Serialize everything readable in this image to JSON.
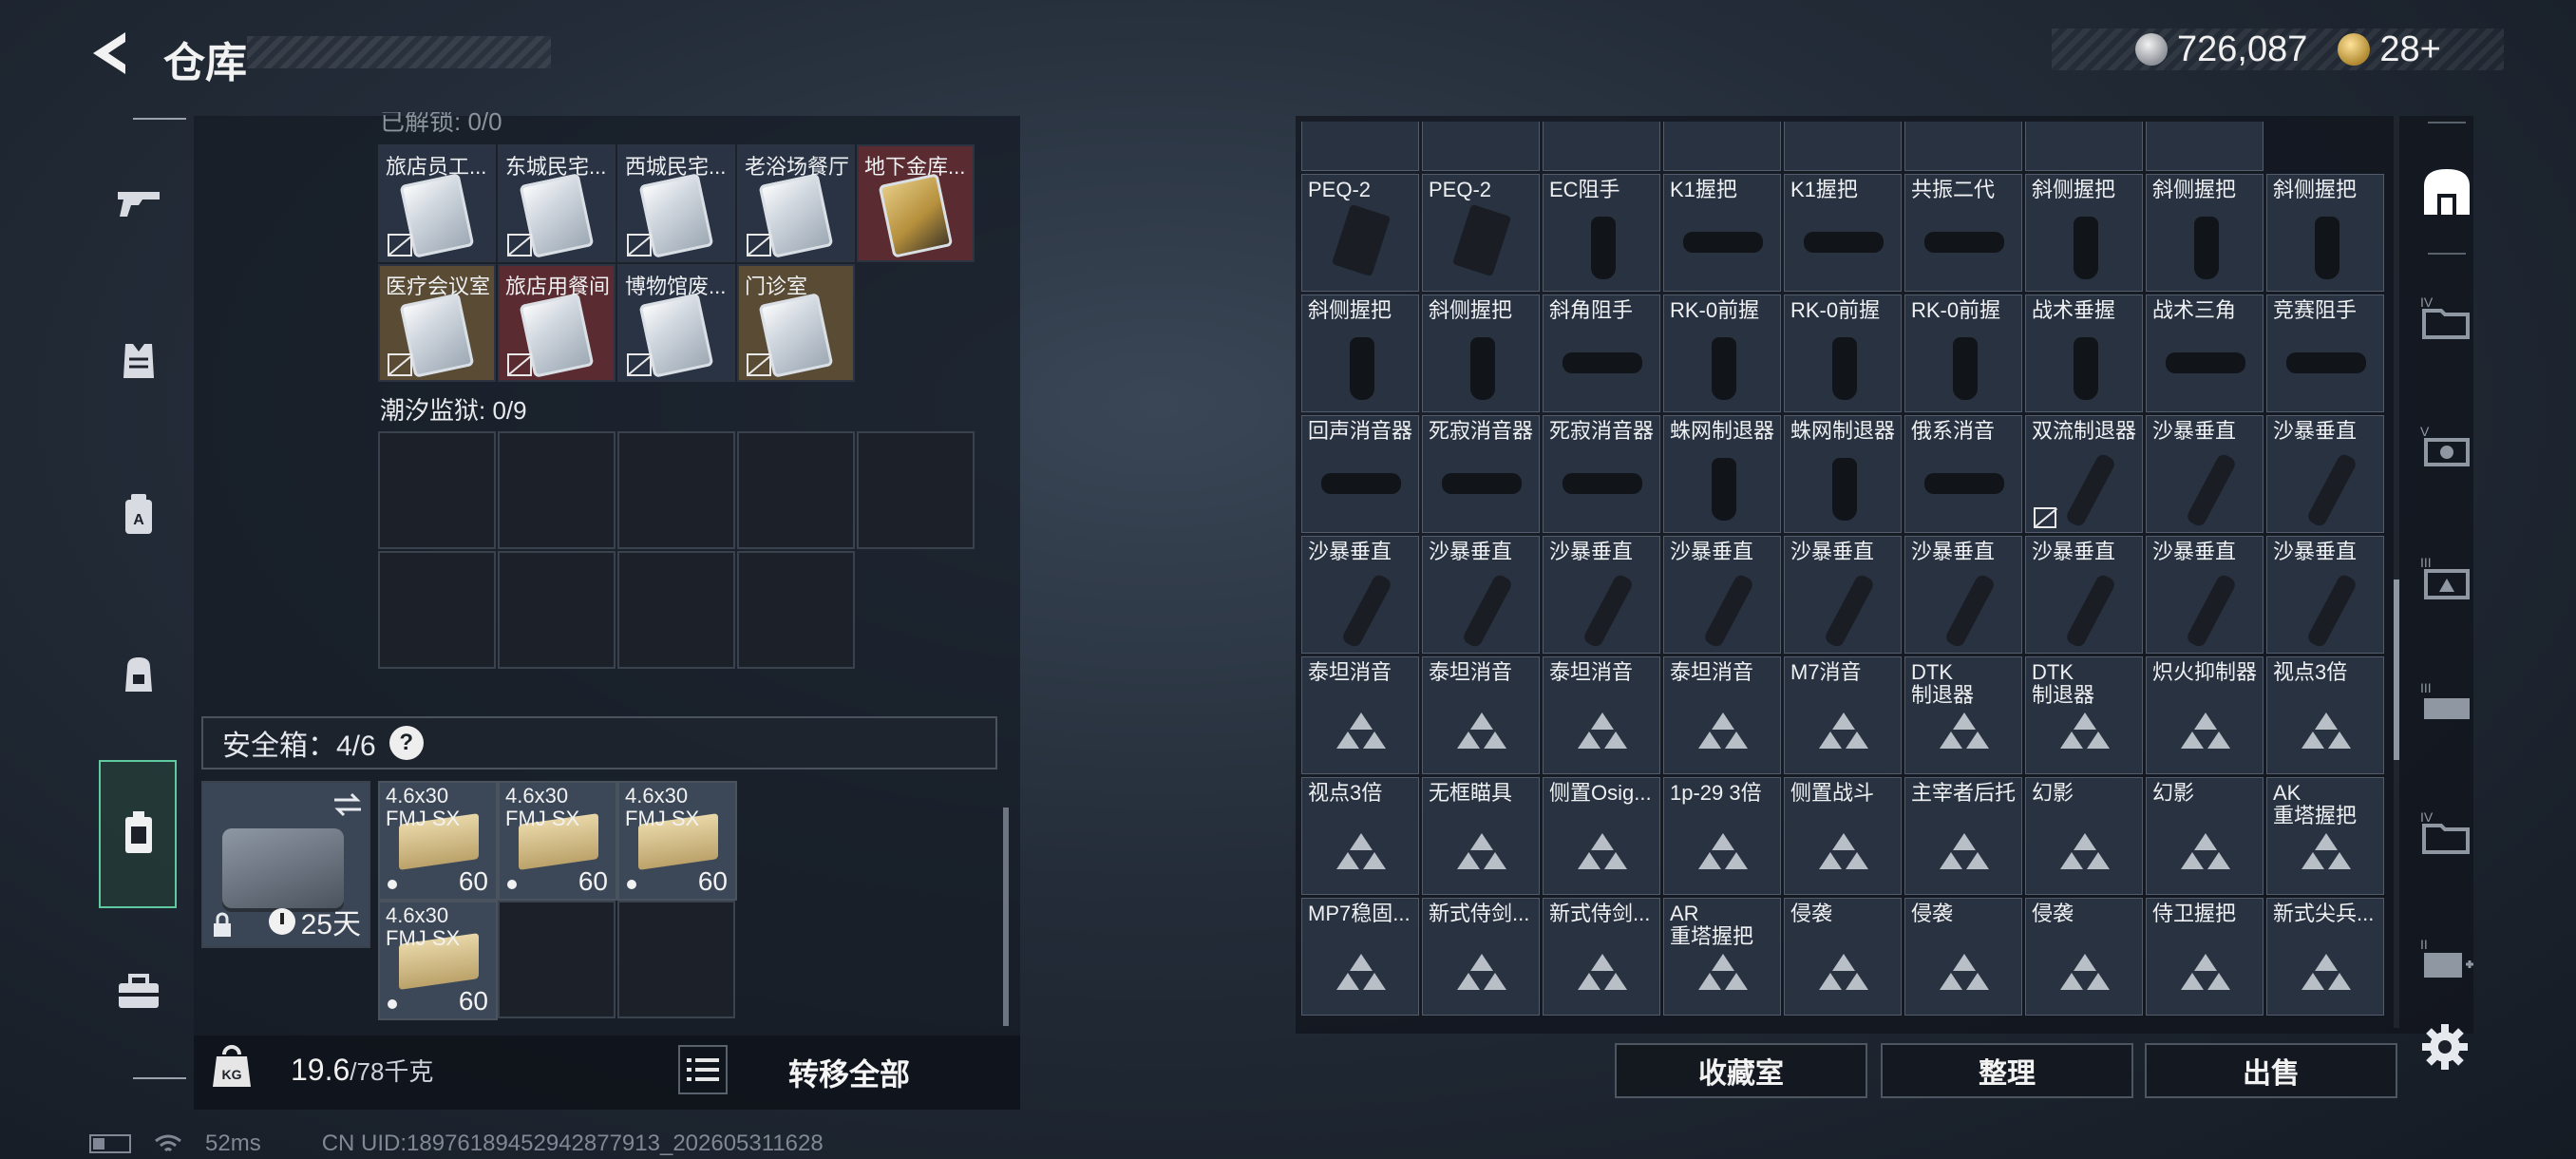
{
  "header": {
    "title": "仓库",
    "currency_silver": "726,087",
    "currency_gold": "28+"
  },
  "left_nav": {
    "items": [
      {
        "name": "weapons",
        "icon": "gun-icon"
      },
      {
        "name": "armor",
        "icon": "vest-icon"
      },
      {
        "name": "helmet",
        "icon": "helmet-icon"
      },
      {
        "name": "backpack",
        "icon": "backpack-icon"
      },
      {
        "name": "container",
        "icon": "safebox-icon",
        "active": true
      },
      {
        "name": "toolbox",
        "icon": "toolbox-icon"
      }
    ]
  },
  "keys_section": {
    "heading": "已解锁: 0/0",
    "cards": [
      {
        "label": "旅店员工...",
        "color": "blue"
      },
      {
        "label": "东城民宅...",
        "color": "blue"
      },
      {
        "label": "西城民宅...",
        "color": "blue"
      },
      {
        "label": "老浴场餐厅",
        "color": "blue"
      },
      {
        "label": "地下金库...",
        "color": "red"
      },
      {
        "label": "医疗会议室",
        "color": "gold"
      },
      {
        "label": "旅店用餐间",
        "color": "red"
      },
      {
        "label": "博物馆废...",
        "color": "blue"
      },
      {
        "label": "门诊室",
        "color": "gold"
      }
    ]
  },
  "prison_section": {
    "label": "潮汐监狱: 0/9"
  },
  "safebox": {
    "label": "安全箱：4/6",
    "help": "?",
    "days": "25天",
    "ammo": [
      {
        "name": "4.6x30\nFMJ SX",
        "qty": "60"
      },
      {
        "name": "4.6x30\nFMJ SX",
        "qty": "60"
      },
      {
        "name": "4.6x30\nFMJ SX",
        "qty": "60"
      },
      {
        "name": "4.6x30\nFMJ SX",
        "qty": "60"
      }
    ]
  },
  "bottom_bar": {
    "weight": "19.6",
    "weight_max": "/78千克",
    "move_all": "转移全部"
  },
  "status_bar": {
    "ping": "52ms",
    "uid": "CN UID:18976189452942877913_202605311628"
  },
  "stash_grid": {
    "rows": [
      [
        {
          "label": "",
          "art": "top"
        },
        {
          "label": "",
          "art": "top"
        },
        {
          "label": "",
          "art": "top"
        },
        {
          "label": "",
          "art": "top"
        },
        {
          "label": "",
          "art": "top"
        },
        {
          "label": "",
          "art": "top"
        },
        {
          "label": "",
          "art": "top"
        },
        {
          "label": "",
          "art": "top"
        }
      ],
      [
        {
          "label": "PEQ-2",
          "art": "peq"
        },
        {
          "label": "PEQ-2",
          "art": "peq"
        },
        {
          "label": "EC阻手",
          "art": "vert"
        },
        {
          "label": "K1握把",
          "art": "rail"
        },
        {
          "label": "K1握把",
          "art": "rail"
        },
        {
          "label": "共振二代",
          "art": "rail"
        },
        {
          "label": "斜侧握把",
          "art": "vert"
        },
        {
          "label": "斜侧握把",
          "art": "vert"
        },
        {
          "label": "斜侧握把",
          "art": "vert"
        }
      ],
      [
        {
          "label": "斜侧握把",
          "art": "vert"
        },
        {
          "label": "斜侧握把",
          "art": "vert"
        },
        {
          "label": "斜角阻手",
          "art": "rail"
        },
        {
          "label": "RK-0前握",
          "art": "vert"
        },
        {
          "label": "RK-0前握",
          "art": "vert"
        },
        {
          "label": "RK-0前握",
          "art": "vert"
        },
        {
          "label": "战术垂握",
          "art": "vert"
        },
        {
          "label": "战术三角",
          "art": "rail"
        },
        {
          "label": "竞赛阻手",
          "art": "rail"
        }
      ],
      [
        {
          "label": "回声消音器",
          "art": "rail"
        },
        {
          "label": "死寂消音器",
          "art": "rail"
        },
        {
          "label": "死寂消音器",
          "art": "rail"
        },
        {
          "label": "蛛网制退器",
          "art": "vert"
        },
        {
          "label": "蛛网制退器",
          "art": "vert"
        },
        {
          "label": "俄系消音",
          "art": "rail"
        },
        {
          "label": "双流制退器",
          "art": "diag",
          "locked": true
        },
        {
          "label": "沙暴垂直",
          "art": "diag"
        },
        {
          "label": "沙暴垂直",
          "art": "diag"
        }
      ],
      [
        {
          "label": "沙暴垂直",
          "art": "diag"
        },
        {
          "label": "沙暴垂直",
          "art": "diag"
        },
        {
          "label": "沙暴垂直",
          "art": "diag"
        },
        {
          "label": "沙暴垂直",
          "art": "diag"
        },
        {
          "label": "沙暴垂直",
          "art": "diag"
        },
        {
          "label": "沙暴垂直",
          "art": "diag"
        },
        {
          "label": "沙暴垂直",
          "art": "diag"
        },
        {
          "label": "沙暴垂直",
          "art": "diag"
        },
        {
          "label": "沙暴垂直",
          "art": "diag"
        }
      ],
      [
        {
          "label": "泰坦消音",
          "art": "tri"
        },
        {
          "label": "泰坦消音",
          "art": "tri"
        },
        {
          "label": "泰坦消音",
          "art": "tri"
        },
        {
          "label": "泰坦消音",
          "art": "tri"
        },
        {
          "label": "M7消音",
          "art": "tri"
        },
        {
          "label": "DTK\n制退器",
          "art": "tri"
        },
        {
          "label": "DTK\n制退器",
          "art": "tri"
        },
        {
          "label": "炽火抑制器",
          "art": "tri"
        },
        {
          "label": "视点3倍",
          "art": "tri"
        }
      ],
      [
        {
          "label": "视点3倍",
          "art": "tri"
        },
        {
          "label": "无框瞄具",
          "art": "tri"
        },
        {
          "label": "侧置Osig...",
          "art": "tri"
        },
        {
          "label": "1p-29 3倍",
          "art": "tri"
        },
        {
          "label": "侧置战斗",
          "art": "tri"
        },
        {
          "label": "主宰者后托",
          "art": "tri"
        },
        {
          "label": "幻影",
          "art": "tri"
        },
        {
          "label": "幻影",
          "art": "tri"
        },
        {
          "label": "AK\n重塔握把",
          "art": "tri"
        }
      ],
      [
        {
          "label": "MP7稳固...",
          "art": "tri"
        },
        {
          "label": "新式侍剑...",
          "art": "tri"
        },
        {
          "label": "新式侍剑...",
          "art": "tri"
        },
        {
          "label": "AR\n重塔握把",
          "art": "tri"
        },
        {
          "label": "侵袭",
          "art": "tri"
        },
        {
          "label": "侵袭",
          "art": "tri"
        },
        {
          "label": "侵袭",
          "art": "tri"
        },
        {
          "label": "侍卫握把",
          "art": "tri"
        },
        {
          "label": "新式尖兵...",
          "art": "tri"
        }
      ]
    ]
  },
  "actions": {
    "collection": "收藏室",
    "organize": "整理",
    "sell": "出售"
  },
  "right_rail": {
    "items": [
      {
        "name": "all",
        "icon": "stash-all-icon",
        "active": true
      },
      {
        "name": "tab-iv-1",
        "icon": "folder-iv-icon"
      },
      {
        "name": "tab-v",
        "icon": "folder-v-icon"
      },
      {
        "name": "tab-iii-1",
        "icon": "folder-iii-a-icon"
      },
      {
        "name": "tab-iii-2",
        "icon": "folder-iii-b-icon"
      },
      {
        "name": "tab-iv-2",
        "icon": "folder-iv-b-icon"
      },
      {
        "name": "tab-ii",
        "icon": "folder-ii-add-icon"
      }
    ]
  }
}
